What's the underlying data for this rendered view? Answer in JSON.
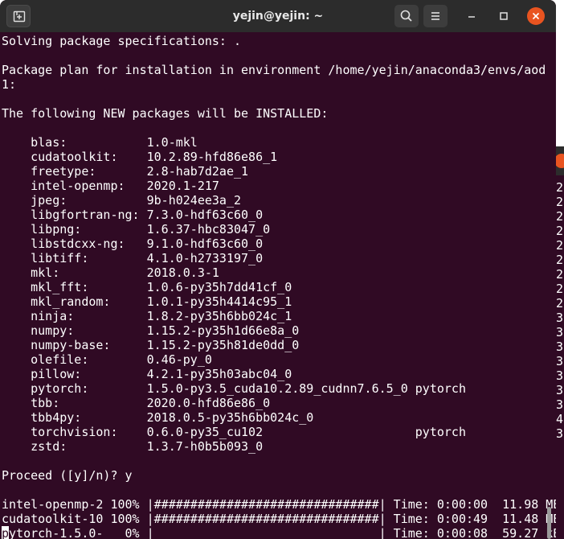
{
  "window": {
    "title": "yejin@yejin: ~"
  },
  "titlebar_icons": {
    "new_tab": "new-tab-icon",
    "search": "search-icon",
    "menu": "hamburger-menu-icon",
    "minimize": "minimize-icon",
    "maximize": "maximize-icon",
    "close": "close-icon"
  },
  "colors": {
    "terminal_background": "#300a24",
    "titlebar": "#2c2c2c",
    "close_button": "#e95420",
    "text": "#ffffff"
  },
  "terminal": {
    "lines": [
      "Solving package specifications: .",
      "",
      "Package plan for installation in environment /home/yejin/anaconda3/envs/aod",
      "1:",
      "",
      "The following NEW packages will be INSTALLED:",
      "",
      "    blas:           1.0-mkl",
      "    cudatoolkit:    10.2.89-hfd86e86_1",
      "    freetype:       2.8-hab7d2ae_1",
      "    intel-openmp:   2020.1-217",
      "    jpeg:           9b-h024ee3a_2",
      "    libgfortran-ng: 7.3.0-hdf63c60_0",
      "    libpng:         1.6.37-hbc83047_0",
      "    libstdcxx-ng:   9.1.0-hdf63c60_0",
      "    libtiff:        4.1.0-h2733197_0",
      "    mkl:            2018.0.3-1",
      "    mkl_fft:        1.0.6-py35h7dd41cf_0",
      "    mkl_random:     1.0.1-py35h4414c95_1",
      "    ninja:          1.8.2-py35h6bb024c_1",
      "    numpy:          1.15.2-py35h1d66e8a_0",
      "    numpy-base:     1.15.2-py35h81de0dd_0",
      "    olefile:        0.46-py_0",
      "    pillow:         4.2.1-py35h03abc04_0",
      "    pytorch:        1.5.0-py3.5_cuda10.2.89_cudnn7.6.5_0 pytorch",
      "    tbb:            2020.0-hfd86e86_0",
      "    tbb4py:         2018.0.5-py35h6bb024c_0",
      "    torchvision:    0.6.0-py35_cu102                     pytorch",
      "    zstd:           1.3.7-h0b5b093_0",
      "",
      "Proceed ([y]/n)? y",
      "",
      "intel-openmp-2 100% |###############################| Time: 0:00:00  11.98 MB/s",
      "cudatoolkit-10 100% |###############################| Time: 0:00:49  11.48 MB/s"
    ],
    "last_line_cursor_char": "p",
    "last_line_rest": "ytorch-1.5.0-   0% |                               | Time: 0:00:08  59.27 kB/s"
  },
  "background_window": {
    "visible_chars": [
      "2",
      "2",
      "2",
      "2",
      "2",
      "2",
      "2",
      "2",
      "2",
      "3",
      "3",
      "3",
      "3",
      "3",
      "3",
      "3",
      "4",
      "3"
    ]
  }
}
